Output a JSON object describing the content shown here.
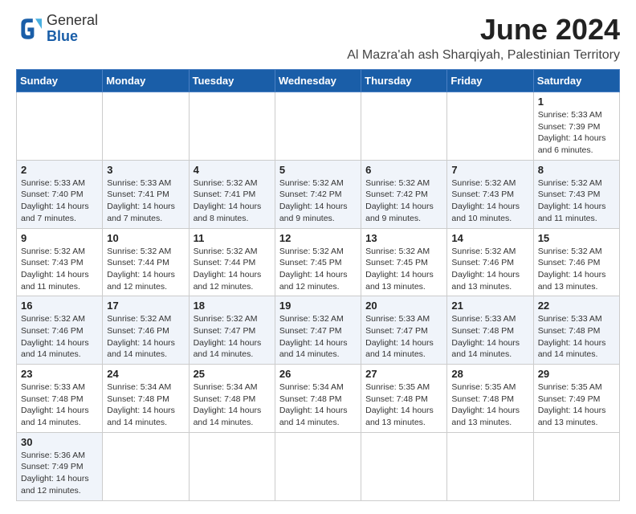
{
  "header": {
    "logo_general": "General",
    "logo_blue": "Blue",
    "main_title": "June 2024",
    "subtitle": "Al Mazra'ah ash Sharqiyah, Palestinian Territory"
  },
  "calendar": {
    "days_of_week": [
      "Sunday",
      "Monday",
      "Tuesday",
      "Wednesday",
      "Thursday",
      "Friday",
      "Saturday"
    ],
    "weeks": [
      [
        {
          "day": null,
          "info": null
        },
        {
          "day": null,
          "info": null
        },
        {
          "day": null,
          "info": null
        },
        {
          "day": null,
          "info": null
        },
        {
          "day": null,
          "info": null
        },
        {
          "day": null,
          "info": null
        },
        {
          "day": "1",
          "info": "Sunrise: 5:33 AM\nSunset: 7:39 PM\nDaylight: 14 hours\nand 6 minutes."
        }
      ],
      [
        {
          "day": "2",
          "info": "Sunrise: 5:33 AM\nSunset: 7:40 PM\nDaylight: 14 hours\nand 7 minutes."
        },
        {
          "day": "3",
          "info": "Sunrise: 5:33 AM\nSunset: 7:41 PM\nDaylight: 14 hours\nand 7 minutes."
        },
        {
          "day": "4",
          "info": "Sunrise: 5:32 AM\nSunset: 7:41 PM\nDaylight: 14 hours\nand 8 minutes."
        },
        {
          "day": "5",
          "info": "Sunrise: 5:32 AM\nSunset: 7:42 PM\nDaylight: 14 hours\nand 9 minutes."
        },
        {
          "day": "6",
          "info": "Sunrise: 5:32 AM\nSunset: 7:42 PM\nDaylight: 14 hours\nand 9 minutes."
        },
        {
          "day": "7",
          "info": "Sunrise: 5:32 AM\nSunset: 7:43 PM\nDaylight: 14 hours\nand 10 minutes."
        },
        {
          "day": "8",
          "info": "Sunrise: 5:32 AM\nSunset: 7:43 PM\nDaylight: 14 hours\nand 11 minutes."
        }
      ],
      [
        {
          "day": "9",
          "info": "Sunrise: 5:32 AM\nSunset: 7:43 PM\nDaylight: 14 hours\nand 11 minutes."
        },
        {
          "day": "10",
          "info": "Sunrise: 5:32 AM\nSunset: 7:44 PM\nDaylight: 14 hours\nand 12 minutes."
        },
        {
          "day": "11",
          "info": "Sunrise: 5:32 AM\nSunset: 7:44 PM\nDaylight: 14 hours\nand 12 minutes."
        },
        {
          "day": "12",
          "info": "Sunrise: 5:32 AM\nSunset: 7:45 PM\nDaylight: 14 hours\nand 12 minutes."
        },
        {
          "day": "13",
          "info": "Sunrise: 5:32 AM\nSunset: 7:45 PM\nDaylight: 14 hours\nand 13 minutes."
        },
        {
          "day": "14",
          "info": "Sunrise: 5:32 AM\nSunset: 7:46 PM\nDaylight: 14 hours\nand 13 minutes."
        },
        {
          "day": "15",
          "info": "Sunrise: 5:32 AM\nSunset: 7:46 PM\nDaylight: 14 hours\nand 13 minutes."
        }
      ],
      [
        {
          "day": "16",
          "info": "Sunrise: 5:32 AM\nSunset: 7:46 PM\nDaylight: 14 hours\nand 14 minutes."
        },
        {
          "day": "17",
          "info": "Sunrise: 5:32 AM\nSunset: 7:46 PM\nDaylight: 14 hours\nand 14 minutes."
        },
        {
          "day": "18",
          "info": "Sunrise: 5:32 AM\nSunset: 7:47 PM\nDaylight: 14 hours\nand 14 minutes."
        },
        {
          "day": "19",
          "info": "Sunrise: 5:32 AM\nSunset: 7:47 PM\nDaylight: 14 hours\nand 14 minutes."
        },
        {
          "day": "20",
          "info": "Sunrise: 5:33 AM\nSunset: 7:47 PM\nDaylight: 14 hours\nand 14 minutes."
        },
        {
          "day": "21",
          "info": "Sunrise: 5:33 AM\nSunset: 7:48 PM\nDaylight: 14 hours\nand 14 minutes."
        },
        {
          "day": "22",
          "info": "Sunrise: 5:33 AM\nSunset: 7:48 PM\nDaylight: 14 hours\nand 14 minutes."
        }
      ],
      [
        {
          "day": "23",
          "info": "Sunrise: 5:33 AM\nSunset: 7:48 PM\nDaylight: 14 hours\nand 14 minutes."
        },
        {
          "day": "24",
          "info": "Sunrise: 5:34 AM\nSunset: 7:48 PM\nDaylight: 14 hours\nand 14 minutes."
        },
        {
          "day": "25",
          "info": "Sunrise: 5:34 AM\nSunset: 7:48 PM\nDaylight: 14 hours\nand 14 minutes."
        },
        {
          "day": "26",
          "info": "Sunrise: 5:34 AM\nSunset: 7:48 PM\nDaylight: 14 hours\nand 14 minutes."
        },
        {
          "day": "27",
          "info": "Sunrise: 5:35 AM\nSunset: 7:48 PM\nDaylight: 14 hours\nand 13 minutes."
        },
        {
          "day": "28",
          "info": "Sunrise: 5:35 AM\nSunset: 7:48 PM\nDaylight: 14 hours\nand 13 minutes."
        },
        {
          "day": "29",
          "info": "Sunrise: 5:35 AM\nSunset: 7:49 PM\nDaylight: 14 hours\nand 13 minutes."
        }
      ],
      [
        {
          "day": "30",
          "info": "Sunrise: 5:36 AM\nSunset: 7:49 PM\nDaylight: 14 hours\nand 12 minutes."
        },
        {
          "day": null,
          "info": null
        },
        {
          "day": null,
          "info": null
        },
        {
          "day": null,
          "info": null
        },
        {
          "day": null,
          "info": null
        },
        {
          "day": null,
          "info": null
        },
        {
          "day": null,
          "info": null
        }
      ]
    ]
  }
}
